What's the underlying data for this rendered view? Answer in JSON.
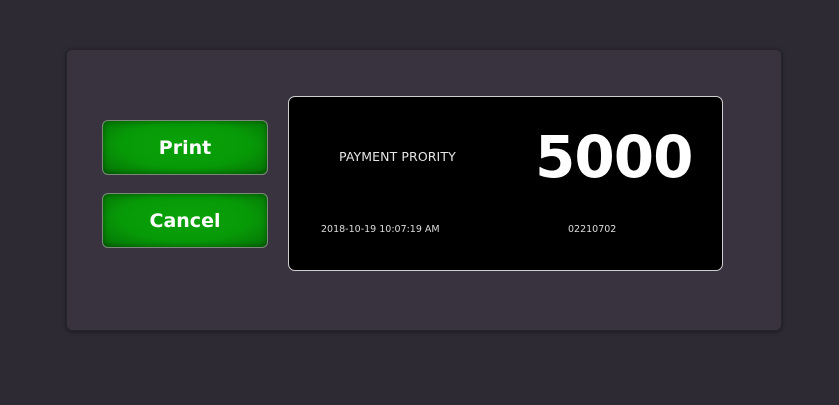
{
  "actions": {
    "print_label": "Print",
    "cancel_label": "Cancel"
  },
  "ticket": {
    "type_label": "PAYMENT PRORITY",
    "number": "5000",
    "datetime": "2018-10-19 10:07:19 AM",
    "code": "02210702"
  },
  "colors": {
    "background": "#2d2a34",
    "panel": "#38333f",
    "button_green": "#079a07",
    "ticket_background": "#000000",
    "ticket_text": "#ffffff"
  }
}
